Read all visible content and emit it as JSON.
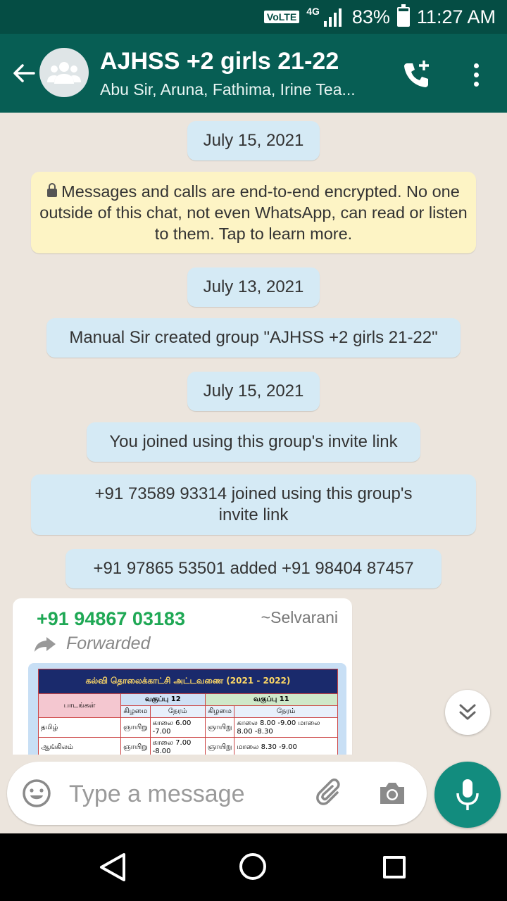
{
  "status_bar": {
    "volte": "VoLTE",
    "network": "4G",
    "battery": "83%",
    "battery_level_percent": 83,
    "time": "11:27 AM"
  },
  "header": {
    "title": "AJHSS +2 girls 21-22",
    "subtitle": "Abu Sir, Aruna, Fathima, Irine Tea...",
    "icons": [
      "back-arrow-icon",
      "group-avatar-icon",
      "add-call-icon",
      "more-vert-icon"
    ]
  },
  "chat": {
    "date1": "July 15, 2021",
    "encryption_notice": "Messages and calls are end-to-end encrypted. No one outside of this chat, not even WhatsApp, can read or listen to them. Tap to learn more.",
    "date2": "July 13, 2021",
    "created": "Manual Sir created group \"AJHSS +2 girls 21-22\"",
    "date3": "July 15, 2021",
    "you_joined": "You joined using this group's invite link",
    "joined_other": "+91 73589 93314 joined using this group's invite link",
    "added": "+91 97865 53501 added +91 98404 87457",
    "message": {
      "sender": "+91 94867 03183",
      "push_name": "~Selvarani",
      "forwarded": "Forwarded",
      "image_table": {
        "banner": "கல்வி தொலைக்காட்சி அட்டவணை (2021 - 2022)",
        "subjects_header": "பாடங்கள்",
        "class12": "வகுப்பு 12",
        "class11": "வகுப்பு 11",
        "day": "கிழமை",
        "time": "நேரம்",
        "rows": [
          {
            "subject": "தமிழ்",
            "d12": "ஞாயிறு",
            "t12": "காலை 6.00 -7.00",
            "d11": "ஞாயிறு",
            "t11": "காலை 8.00 -9.00 மாலை 8.00 -8.30"
          },
          {
            "subject": "ஆங்கிலம்",
            "d12": "ஞாயிறு",
            "t12": "காலை 7.00 -8.00",
            "d11": "ஞாயிறு",
            "t11": "மாலை 8.30 -9.00"
          }
        ]
      }
    }
  },
  "composer": {
    "placeholder": "Type a message",
    "icons": [
      "emoji-icon",
      "attach-icon",
      "camera-icon",
      "mic-icon"
    ]
  },
  "colors": {
    "header": "#075e54",
    "status_bar": "#054d44",
    "accent": "#128c7e",
    "sender": "#1fa855",
    "system_chip": "#d5eaf5",
    "encryption_bg": "#fdf4c5"
  }
}
